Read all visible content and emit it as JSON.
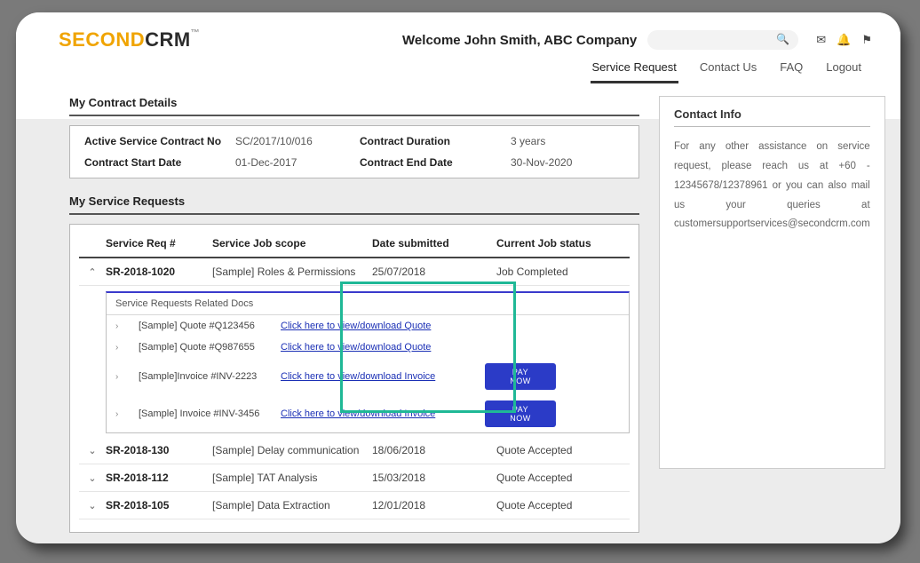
{
  "logo": {
    "part1": "SECOND",
    "part2": "CRM",
    "tm": "™"
  },
  "welcome": "Welcome John Smith, ABC Company",
  "search": {
    "placeholder": ""
  },
  "nav": {
    "items": [
      "Service Request",
      "Contact Us",
      "FAQ",
      "Logout"
    ],
    "active_index": 0
  },
  "contract": {
    "title": "My Contract Details",
    "fields": {
      "contract_no_label": "Active Service Contract No",
      "contract_no": "SC/2017/10/016",
      "duration_label": "Contract Duration",
      "duration": "3 years",
      "start_label": "Contract Start Date",
      "start": "01-Dec-2017",
      "end_label": "Contract End Date",
      "end": "30-Nov-2020"
    }
  },
  "requests": {
    "title": "My Service Requests",
    "headers": [
      "Service Req #",
      "Service Job scope",
      "Date submitted",
      "Current Job status"
    ],
    "rows": [
      {
        "expanded": true,
        "req": "SR-2018-1020",
        "scope": "[Sample] Roles & Permissions",
        "date": "25/07/2018",
        "status": "Job Completed"
      },
      {
        "expanded": false,
        "req": "SR-2018-130",
        "scope": "[Sample] Delay communication",
        "date": "18/06/2018",
        "status": "Quote Accepted"
      },
      {
        "expanded": false,
        "req": "SR-2018-112",
        "scope": "[Sample] TAT Analysis",
        "date": "15/03/2018",
        "status": "Quote Accepted"
      },
      {
        "expanded": false,
        "req": "SR-2018-105",
        "scope": "[Sample] Data Extraction",
        "date": "12/01/2018",
        "status": "Quote Accepted"
      }
    ],
    "docs": {
      "title": "Service Requests Related Docs",
      "items": [
        {
          "name": "[Sample] Quote #Q123456",
          "link": "Click here to view/download Quote",
          "pay": false
        },
        {
          "name": "[Sample] Quote #Q987655",
          "link": "Click here to view/download Quote",
          "pay": false
        },
        {
          "name": "[Sample]Invoice #INV-2223",
          "link": "Click here to view/download Invoice",
          "pay": true
        },
        {
          "name": "[Sample] Invoice #INV-3456",
          "link": "Click here to view/download Invoice",
          "pay": true
        }
      ],
      "pay_label": "PAY NOW"
    }
  },
  "contact": {
    "title": "Contact Info",
    "body": "For any other assistance on service request, please reach us at +60 - 12345678/12378961 or you can also mail us your queries at customersupportservices@secondcrm.com"
  }
}
